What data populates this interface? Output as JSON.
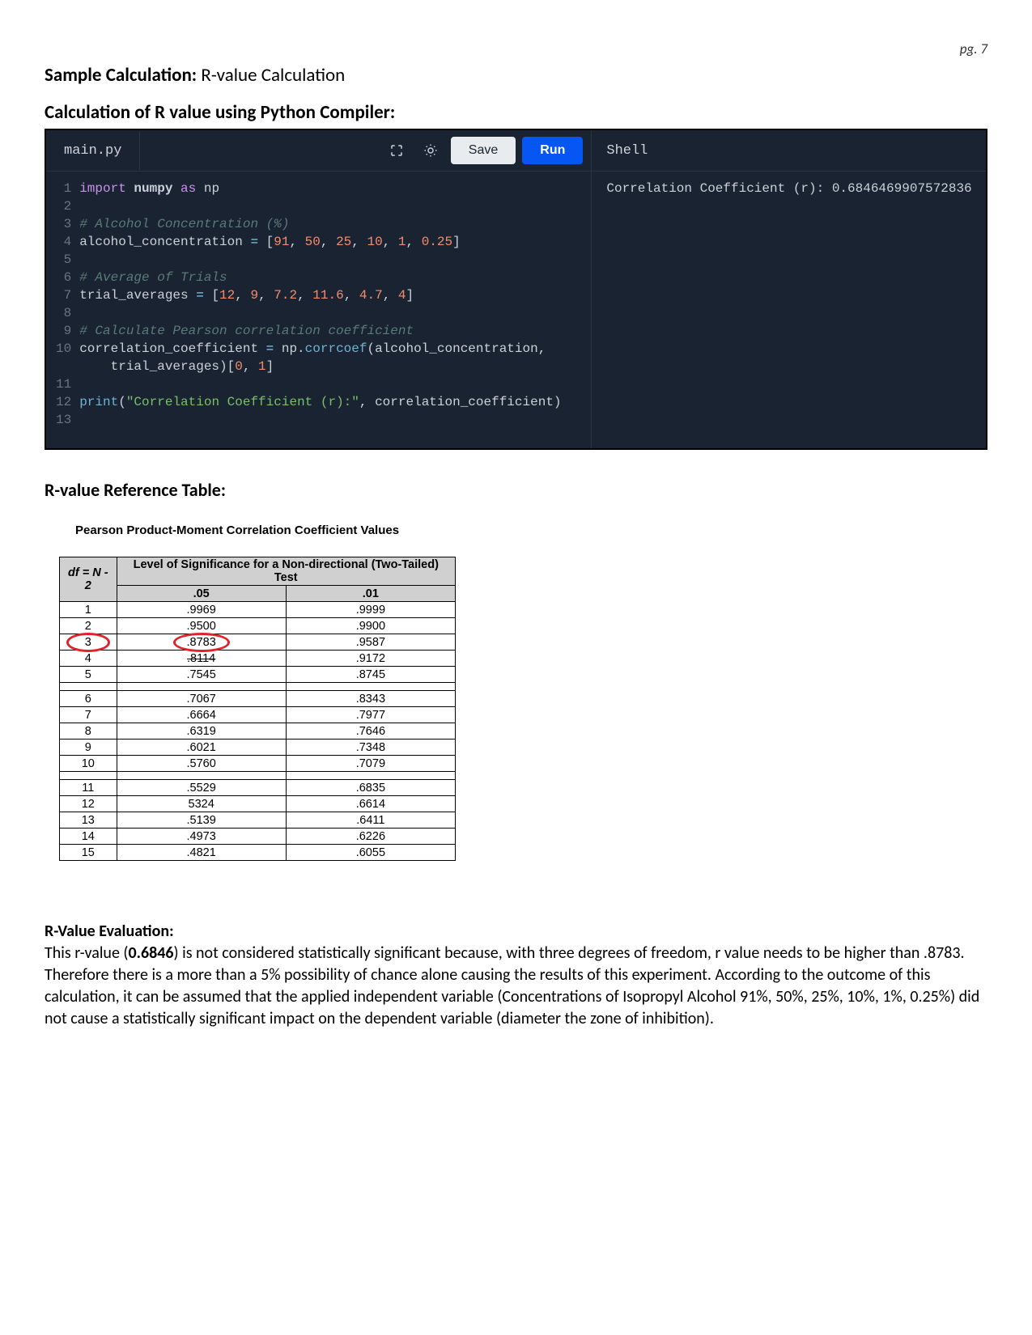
{
  "page_number": "pg. 7",
  "title_bold": "Sample Calculation:",
  "title_rest": " R-value Calculation",
  "section_calc": "Calculation of R value using Python Compiler:",
  "ide": {
    "file": "main.py",
    "save": "Save",
    "run": "Run",
    "shell": "Shell",
    "shell_output": "Correlation Coefficient (r): 0.6846469907572836",
    "code": {
      "line1_kw1": "import",
      "line1_mod": "numpy",
      "line1_kw2": "as",
      "line1_alias": "np",
      "line3": "# Alcohol Concentration (%)",
      "line4_var": "alcohol_concentration ",
      "line4_eq": "=",
      "line4_open": " [",
      "line4_n1": "91",
      "line4_n2": "50",
      "line4_n3": "25",
      "line4_n4": "10",
      "line4_n5": "1",
      "line4_n6": "0.25",
      "line4_close": "]",
      "line6": "# Average of Trials",
      "line7_var": "trial_averages ",
      "line7_eq": "=",
      "line7_open": " [",
      "line7_n1": "12",
      "line7_n2": "9",
      "line7_n3": "7.2",
      "line7_n4": "11.6",
      "line7_n5": "4.7",
      "line7_n6": "4",
      "line7_close": "]",
      "line9": "# Calculate Pearson correlation coefficient",
      "line10_a": "correlation_coefficient ",
      "line10_eq": "=",
      "line10_b": " np.",
      "line10_fn": "corrcoef",
      "line10_c": "(alcohol_concentration,",
      "line10d_a": "    trial_averages)[",
      "line10d_n1": "0",
      "line10d_n2": "1",
      "line10d_b": "]",
      "line12_fn": "print",
      "line12_open": "(",
      "line12_str": "\"Correlation Coefficient (r):\"",
      "line12_rest": ", correlation_coefficient)"
    }
  },
  "ref_heading": "R-value Reference Table:",
  "ref_subtitle": "Pearson Product-Moment Correlation Coefficient Values",
  "ref_table": {
    "header_top": "Level of Significance for a Non-directional (Two-Tailed) Test",
    "hdr_df": "df = N - 2",
    "hdr_05": ".05",
    "hdr_01": ".01",
    "rows": [
      {
        "df": "1",
        "a": ".9969",
        "b": ".9999"
      },
      {
        "df": "2",
        "a": ".9500",
        "b": ".9900"
      },
      {
        "df": "3",
        "a": ".8783",
        "b": ".9587"
      },
      {
        "df": "4",
        "a": ".8114",
        "b": ".9172"
      },
      {
        "df": "5",
        "a": ".7545",
        "b": ".8745"
      },
      {
        "df": "6",
        "a": ".7067",
        "b": ".8343"
      },
      {
        "df": "7",
        "a": ".6664",
        "b": ".7977"
      },
      {
        "df": "8",
        "a": ".6319",
        "b": ".7646"
      },
      {
        "df": "9",
        "a": ".6021",
        "b": ".7348"
      },
      {
        "df": "10",
        "a": ".5760",
        "b": ".7079"
      },
      {
        "df": "11",
        "a": ".5529",
        "b": ".6835"
      },
      {
        "df": "12",
        "a": "5324",
        "b": ".6614"
      },
      {
        "df": "13",
        "a": ".5139",
        "b": ".6411"
      },
      {
        "df": "14",
        "a": ".4973",
        "b": ".6226"
      },
      {
        "df": "15",
        "a": ".4821",
        "b": ".6055"
      }
    ]
  },
  "eval_heading": "R-Value Evaluation:",
  "eval_body_pre": "This r-value (",
  "eval_body_bold": "0.6846",
  "eval_body_post": ")  is not considered statistically significant because, with three degrees of freedom, r value needs to be higher than .8783. Therefore there is a more than a 5% possibility of chance alone causing the results of this experiment. According to the outcome of this calculation, it can be assumed that the applied independent variable (Concentrations of Isopropyl Alcohol 91%, 50%, 25%, 10%, 1%, 0.25%) did not cause a statistically significant impact on the dependent variable (diameter the zone of inhibition).",
  "chart_data": {
    "type": "table",
    "title": "Pearson Product-Moment Correlation Coefficient Values",
    "columns": [
      "df = N - 2",
      ".05",
      ".01"
    ],
    "rows": [
      [
        1,
        0.9969,
        0.9999
      ],
      [
        2,
        0.95,
        0.99
      ],
      [
        3,
        0.8783,
        0.9587
      ],
      [
        4,
        0.8114,
        0.9172
      ],
      [
        5,
        0.7545,
        0.8745
      ],
      [
        6,
        0.7067,
        0.8343
      ],
      [
        7,
        0.6664,
        0.7977
      ],
      [
        8,
        0.6319,
        0.7646
      ],
      [
        9,
        0.6021,
        0.7348
      ],
      [
        10,
        0.576,
        0.7079
      ],
      [
        11,
        0.5529,
        0.6835
      ],
      [
        12,
        0.5324,
        0.6614
      ],
      [
        13,
        0.5139,
        0.6411
      ],
      [
        14,
        0.4973,
        0.6226
      ],
      [
        15,
        0.4821,
        0.6055
      ]
    ]
  }
}
